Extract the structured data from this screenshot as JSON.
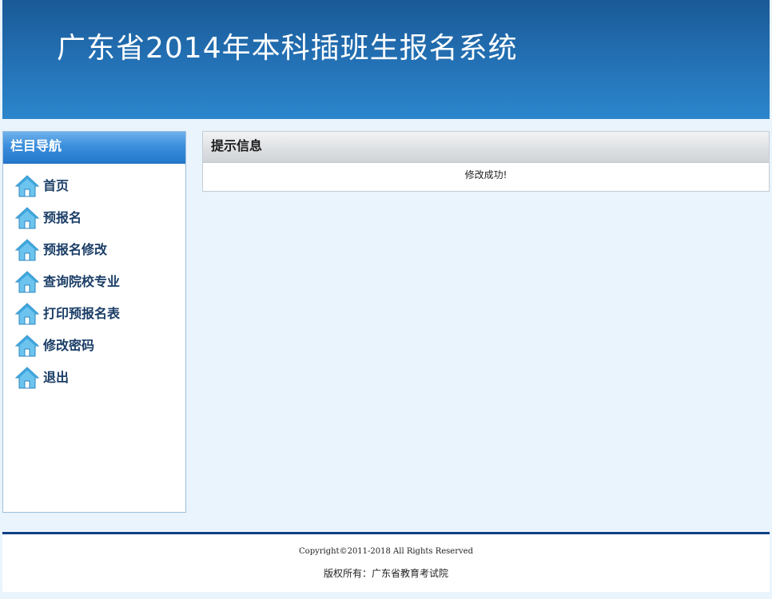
{
  "header": {
    "title": "广东省2014年本科插班生报名系统"
  },
  "sidebar": {
    "title": "栏目导航",
    "items": [
      {
        "label": "首页",
        "icon": "home-icon"
      },
      {
        "label": "预报名",
        "icon": "home-icon"
      },
      {
        "label": "预报名修改",
        "icon": "home-icon"
      },
      {
        "label": "查询院校专业",
        "icon": "home-icon"
      },
      {
        "label": "打印预报名表",
        "icon": "home-icon"
      },
      {
        "label": "修改密码",
        "icon": "home-icon"
      },
      {
        "label": "退出",
        "icon": "home-icon"
      }
    ]
  },
  "panel": {
    "title": "提示信息",
    "message": "修改成功!"
  },
  "footer": {
    "copyright": "Copyright©2011-2018 All Rights Reserved",
    "owner": "版权所有：广东省教育考试院"
  },
  "colors": {
    "header_top": "#1a5a97",
    "header_bottom": "#2c86cc",
    "nav_text": "#1a3d66",
    "page_background": "#eaf4fc",
    "footer_line": "#0f3f86"
  }
}
